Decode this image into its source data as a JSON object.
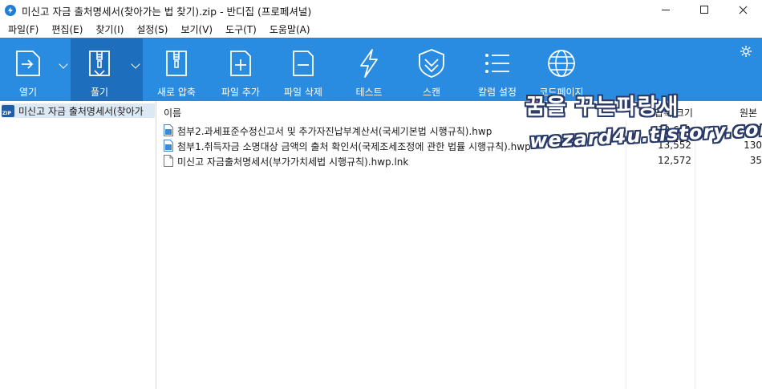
{
  "window": {
    "title": "미신고 자금 출처명세서(찾아가는 법 찾기).zip - 반디집 (프로페셔널)"
  },
  "menu": [
    {
      "label": "파일(F)"
    },
    {
      "label": "편집(E)"
    },
    {
      "label": "찾기(I)"
    },
    {
      "label": "설정(S)"
    },
    {
      "label": "보기(V)"
    },
    {
      "label": "도구(T)"
    },
    {
      "label": "도움말(A)"
    }
  ],
  "toolbar": {
    "open_label": "열기",
    "extract_label": "풀기",
    "new_archive_label": "새로 압축",
    "add_file_label": "파일 추가",
    "delete_file_label": "파일 삭제",
    "test_label": "테스트",
    "scan_label": "스캔",
    "column_settings_label": "칼럼 설정",
    "codepage_label": "코드페이지"
  },
  "tree": {
    "root_label": "미신고 자금 출처명세서(찾아가",
    "zip_badge": "ZIP"
  },
  "list": {
    "headers": {
      "name": "이름",
      "size": "압축 크기",
      "original": "원본"
    },
    "rows": [
      {
        "name": "첨부2.과세표준수정신고서 및 추가자진납부계산서(국세기본법 시행규칙).hwp",
        "size": "12,651",
        "original": "19",
        "icon": "hwp-file-icon"
      },
      {
        "name": "첨부1.취득자금 소명대상 금액의 출처 확인서(국제조세조정에 관한 법률 시행규칙).hwp",
        "size": "13,552",
        "original": "130",
        "icon": "hwp-file-icon"
      },
      {
        "name": "미신고 자금출처명세서(부가가치세법 시행규칙).hwp.lnk",
        "size": "12,572",
        "original": "35",
        "icon": "shortcut-file-icon"
      }
    ]
  },
  "watermark": {
    "line1": "꿈을 꾸는파랑새",
    "line2": "wezard4u.tistory.com"
  },
  "colors": {
    "toolbar": "#2a8ce0",
    "toolbar_active": "#1d6fbe",
    "tree_selected": "#dde8f5"
  }
}
